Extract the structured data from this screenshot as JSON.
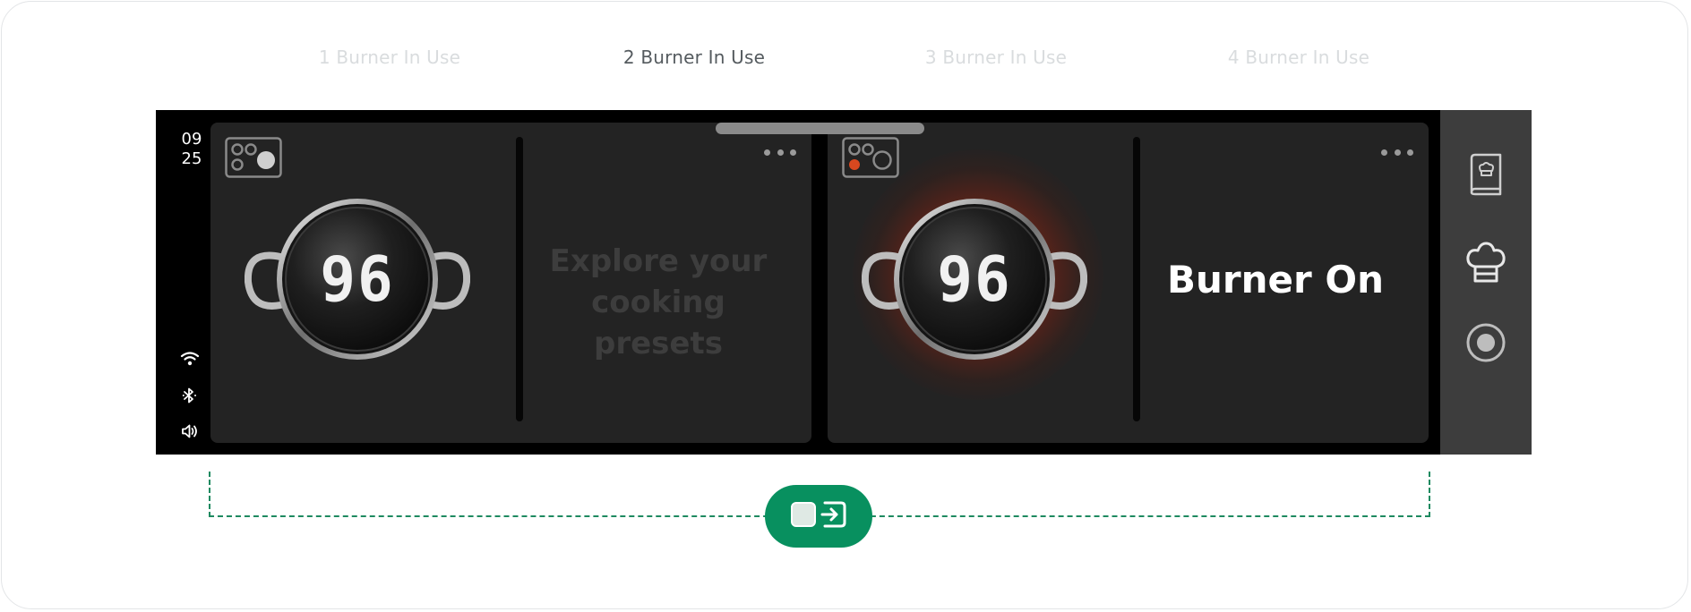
{
  "tabs": [
    {
      "label": "1 Burner In Use",
      "active": false
    },
    {
      "label": "2 Burner In Use",
      "active": true
    },
    {
      "label": "3 Burner In Use",
      "active": false
    },
    {
      "label": "4 Burner In Use",
      "active": false
    }
  ],
  "status_bar": {
    "time_hour": "09",
    "time_minute": "25",
    "icons": [
      "wifi-icon",
      "bluetooth-icon",
      "volume-icon"
    ]
  },
  "burners": [
    {
      "position_icon": "burner-position-right-icon",
      "temperature": "96",
      "heating": false,
      "panel_text": "Explore your cooking presets"
    },
    {
      "position_icon": "burner-position-left-active-icon",
      "temperature": "96",
      "heating": true,
      "panel_text": "Burner On"
    }
  ],
  "sidebar": {
    "items": [
      "recipe-book-icon",
      "chef-hat-icon",
      "record-icon"
    ]
  },
  "mode_toggle": {
    "icon": "exit-split-view-icon"
  },
  "colors": {
    "accent": "#08905f",
    "heat": "#d9481f",
    "screen_bg": "#000000",
    "panel_bg": "#232323",
    "sidebar_bg": "#3d3d3d"
  }
}
